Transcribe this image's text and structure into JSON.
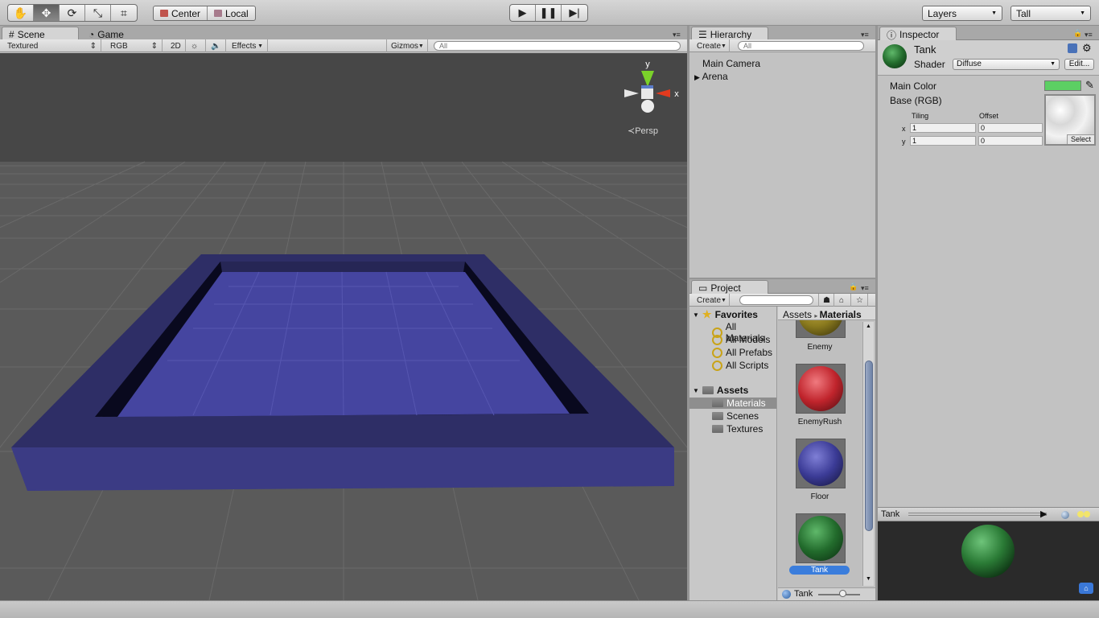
{
  "toolbar": {
    "transform_tools": [
      "hand-tool",
      "move-tool",
      "rotate-tool",
      "scale-tool",
      "rect-tool"
    ],
    "pivot_label": "Center",
    "space_label": "Local",
    "play": "▶",
    "pause": "❚❚",
    "step": "▶|",
    "layers_label": "Layers",
    "layout_label": "Tall"
  },
  "scene_panel": {
    "tabs": [
      "Scene",
      "Game"
    ],
    "render_mode": "Textured",
    "color_mode": "RGB",
    "btn_2d": "2D",
    "effects": "Effects",
    "gizmos": "Gizmos",
    "search_placeholder": "All",
    "axis_y": "y",
    "axis_x": "x",
    "persp": "Persp",
    "colors": {
      "arena_top": "#2e2e66",
      "arena_side": "#3b3b84",
      "floor": "#4545a0"
    }
  },
  "hierarchy": {
    "tab": "Hierarchy",
    "create": "Create",
    "search_placeholder": "All",
    "items": [
      "Main Camera",
      "Arena"
    ]
  },
  "project": {
    "tab": "Project",
    "create": "Create",
    "favorites_label": "Favorites",
    "favorites": [
      "All Materials",
      "All Models",
      "All Prefabs",
      "All Scripts"
    ],
    "assets_label": "Assets",
    "folders": [
      "Materials",
      "Scenes",
      "Textures"
    ],
    "breadcrumb_root": "Assets",
    "breadcrumb_current": "Materials",
    "materials": [
      {
        "name": "Enemy",
        "color": "#8a7a1e"
      },
      {
        "name": "EnemyRush",
        "color": "#c0242c"
      },
      {
        "name": "Floor",
        "color": "#3b3b96"
      },
      {
        "name": "Tank",
        "color": "#226b2c"
      }
    ],
    "footer_selected": "Tank"
  },
  "inspector": {
    "tab": "Inspector",
    "object_name": "Tank",
    "shader_label": "Shader",
    "shader_value": "Diffuse",
    "edit_button": "Edit...",
    "main_color_label": "Main Color",
    "main_color": "#5ccf63",
    "base_label": "Base (RGB)",
    "tiling_label": "Tiling",
    "offset_label": "Offset",
    "x_label": "x",
    "y_label": "y",
    "tiling_x": "1",
    "tiling_y": "1",
    "offset_x": "0",
    "offset_y": "0",
    "select_button": "Select",
    "preview_title": "Tank"
  }
}
